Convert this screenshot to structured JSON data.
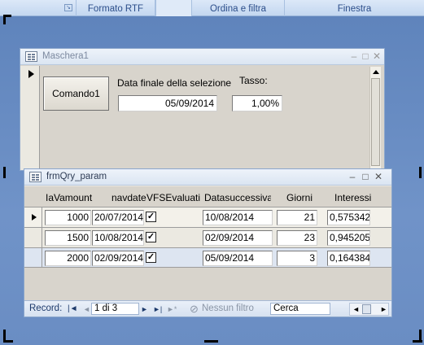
{
  "ribbon": {
    "formato_rtf": "Formato RTF",
    "ordina_filtra": "Ordina e filtra",
    "finestra": "Finestra"
  },
  "maschera1": {
    "title": "Maschera1",
    "command_label": "Comando1",
    "data_label": "Data finale della selezione",
    "data_value": "05/09/2014",
    "tasso_label": "Tasso:",
    "tasso_value": "1,00%"
  },
  "frmqry": {
    "title": "frmQry_param",
    "columns": [
      "IaVamount",
      "navdate",
      "VFSEvaluation",
      "Datasuccessiva",
      "Giorni",
      "Interessi"
    ],
    "rows": [
      {
        "amount": "1000",
        "navdate": "20/07/2014",
        "checked": true,
        "datasucc": "10/08/2014",
        "giorni": "21",
        "interessi": "0,575342"
      },
      {
        "amount": "1500",
        "navdate": "10/08/2014",
        "checked": true,
        "datasucc": "02/09/2014",
        "giorni": "23",
        "interessi": "0,945205"
      },
      {
        "amount": "2000",
        "navdate": "02/09/2014",
        "checked": true,
        "datasucc": "05/09/2014",
        "giorni": "3",
        "interessi": "0,164384"
      }
    ]
  },
  "navigation": {
    "record_label": "Record:",
    "first_glyph": "|◄",
    "prev_glyph": "◄",
    "position": "1 di 3",
    "next_glyph": "►",
    "last_glyph": "►|",
    "new_glyph": "►*",
    "filter_label": "Nessun filtro",
    "search_placeholder": "Cerca"
  },
  "window_controls": {
    "minimize": "–",
    "maximize": "□",
    "close": "✕"
  },
  "colors": {
    "workspace": "#6a8fc4",
    "window_face": "#ebe9e1",
    "nav_text": "#1d3a6b"
  }
}
